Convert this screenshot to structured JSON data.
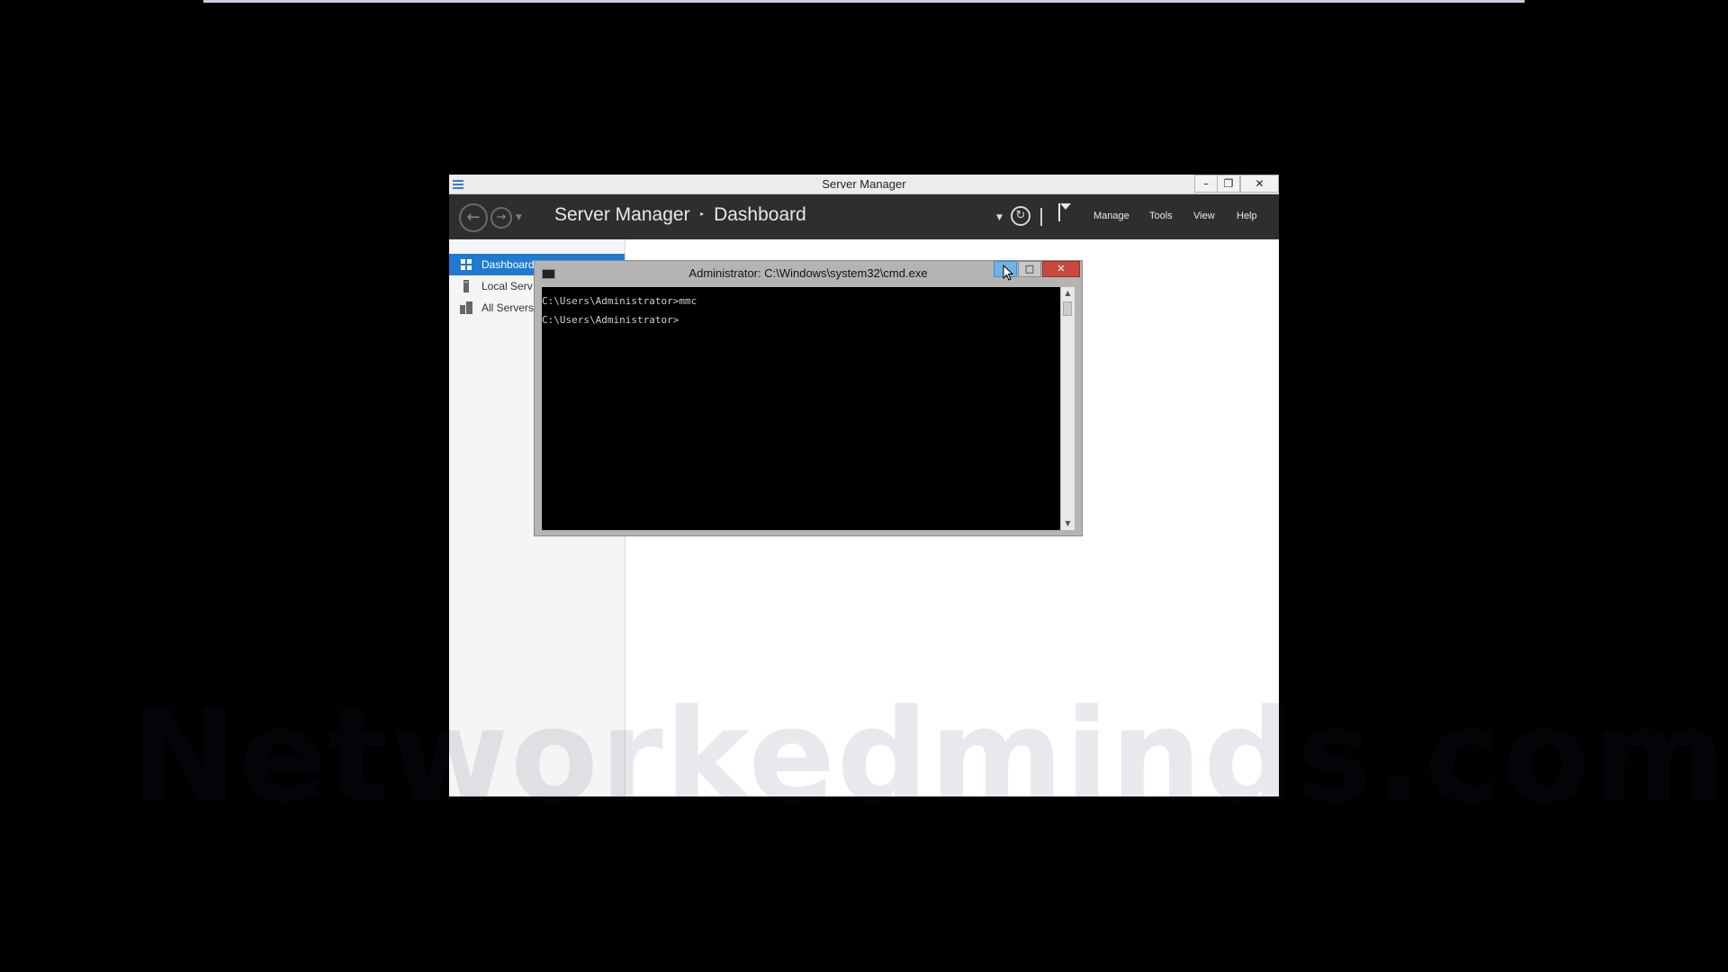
{
  "server_manager": {
    "window_title": "Server Manager",
    "controls": {
      "minimize": "–",
      "restore": "❐",
      "close": "✕"
    },
    "breadcrumb": {
      "root": "Server Manager",
      "separator": "‣",
      "current": "Dashboard"
    },
    "menu": {
      "manage": "Manage",
      "tools": "Tools",
      "view": "View",
      "help": "Help"
    },
    "sidebar": {
      "items": [
        {
          "label": "Dashboard",
          "icon": "dashboard-icon"
        },
        {
          "label": "Local Serv",
          "icon": "server-icon"
        },
        {
          "label": "All Servers",
          "icon": "servers-icon"
        }
      ]
    }
  },
  "cmd": {
    "title": "Administrator: C:\\Windows\\system32\\cmd.exe",
    "controls": {
      "minimize": "–",
      "maximize": "□",
      "close": "✕"
    },
    "lines": [
      "C:\\Users\\Administrator>mmc",
      "C:\\Users\\Administrator>"
    ]
  },
  "watermark": "Networkedminds.com",
  "colors": {
    "accent": "#1e7bd0",
    "toolbar": "#2e2e2e",
    "cmd_close": "#c8493e"
  }
}
